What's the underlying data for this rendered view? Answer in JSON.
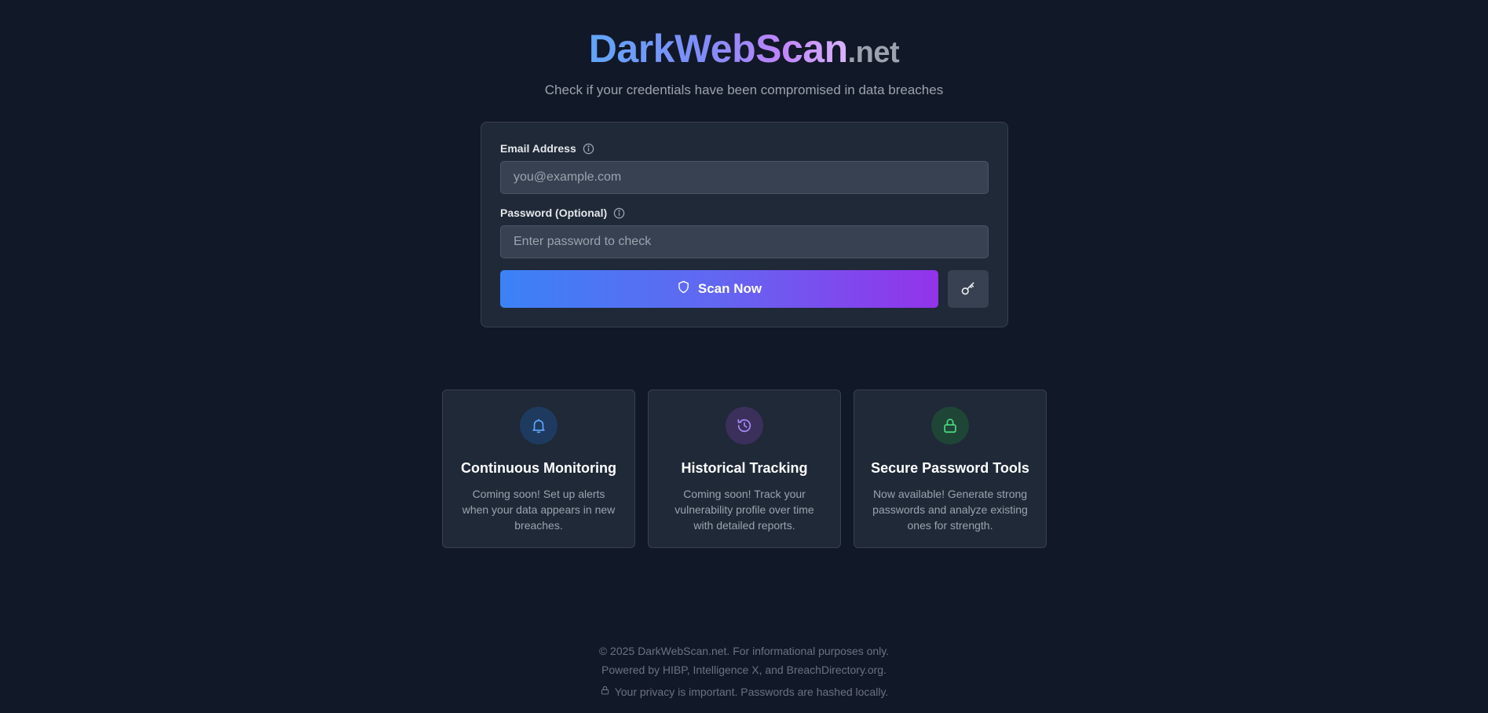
{
  "header": {
    "logo_main": "DarkWebScan",
    "logo_tld": ".net",
    "tagline": "Check if your credentials have been compromised in data breaches"
  },
  "form": {
    "email_label": "Email Address",
    "email_placeholder": "you@example.com",
    "email_value": "",
    "password_label": "Password (Optional)",
    "password_placeholder": "Enter password to check",
    "password_value": "",
    "scan_label": "Scan Now",
    "scan_icon": "shield-icon",
    "key_icon": "key-icon"
  },
  "features": [
    {
      "icon": "bell-icon",
      "icon_color": "#60a5fa",
      "icon_bg": "#1e3a5f",
      "title": "Continuous Monitoring",
      "desc": "Coming soon! Set up alerts when your data appears in new breaches."
    },
    {
      "icon": "history-icon",
      "icon_color": "#a78bfa",
      "icon_bg": "#3b2f5c",
      "title": "Historical Tracking",
      "desc": "Coming soon! Track your vulnerability profile over time with detailed reports."
    },
    {
      "icon": "lock-icon",
      "icon_color": "#4ade80",
      "icon_bg": "#1f4536",
      "title": "Secure Password Tools",
      "desc": "Now available! Generate strong passwords and analyze existing ones for strength."
    }
  ],
  "footer": {
    "copyright": "© 2025 DarkWebScan.net. For informational purposes only.",
    "powered_by": "Powered by HIBP, Intelligence X, and BreachDirectory.org.",
    "privacy": "Your privacy is important. Passwords are hashed locally."
  },
  "colors": {
    "background": "#111827",
    "card": "#1f2937",
    "gradient_start": "#3b82f6",
    "gradient_end": "#9333ea"
  }
}
